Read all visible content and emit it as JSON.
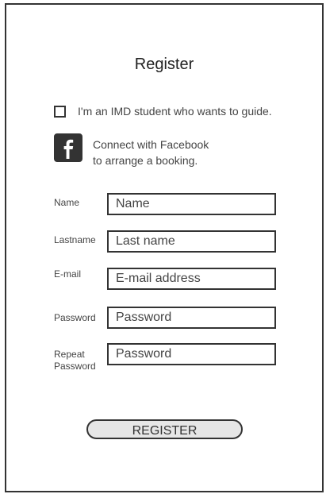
{
  "page": {
    "title": "Register"
  },
  "guide_option": {
    "label": "I'm an IMD student who wants to guide.",
    "checked": false
  },
  "facebook": {
    "icon": "facebook-icon",
    "line1": "Connect with Facebook",
    "line2": "to arrange a booking."
  },
  "form": {
    "name": {
      "label": "Name",
      "placeholder": "Name"
    },
    "lastname": {
      "label": "Lastname",
      "placeholder": "Last name"
    },
    "email": {
      "label": "E-mail",
      "placeholder": "E-mail address"
    },
    "password": {
      "label": "Password",
      "placeholder": "Password"
    },
    "repeat_password": {
      "label_line1": "Repeat",
      "label_line2": "Password",
      "placeholder": "Password"
    }
  },
  "register_button": {
    "label": "REGISTER"
  }
}
